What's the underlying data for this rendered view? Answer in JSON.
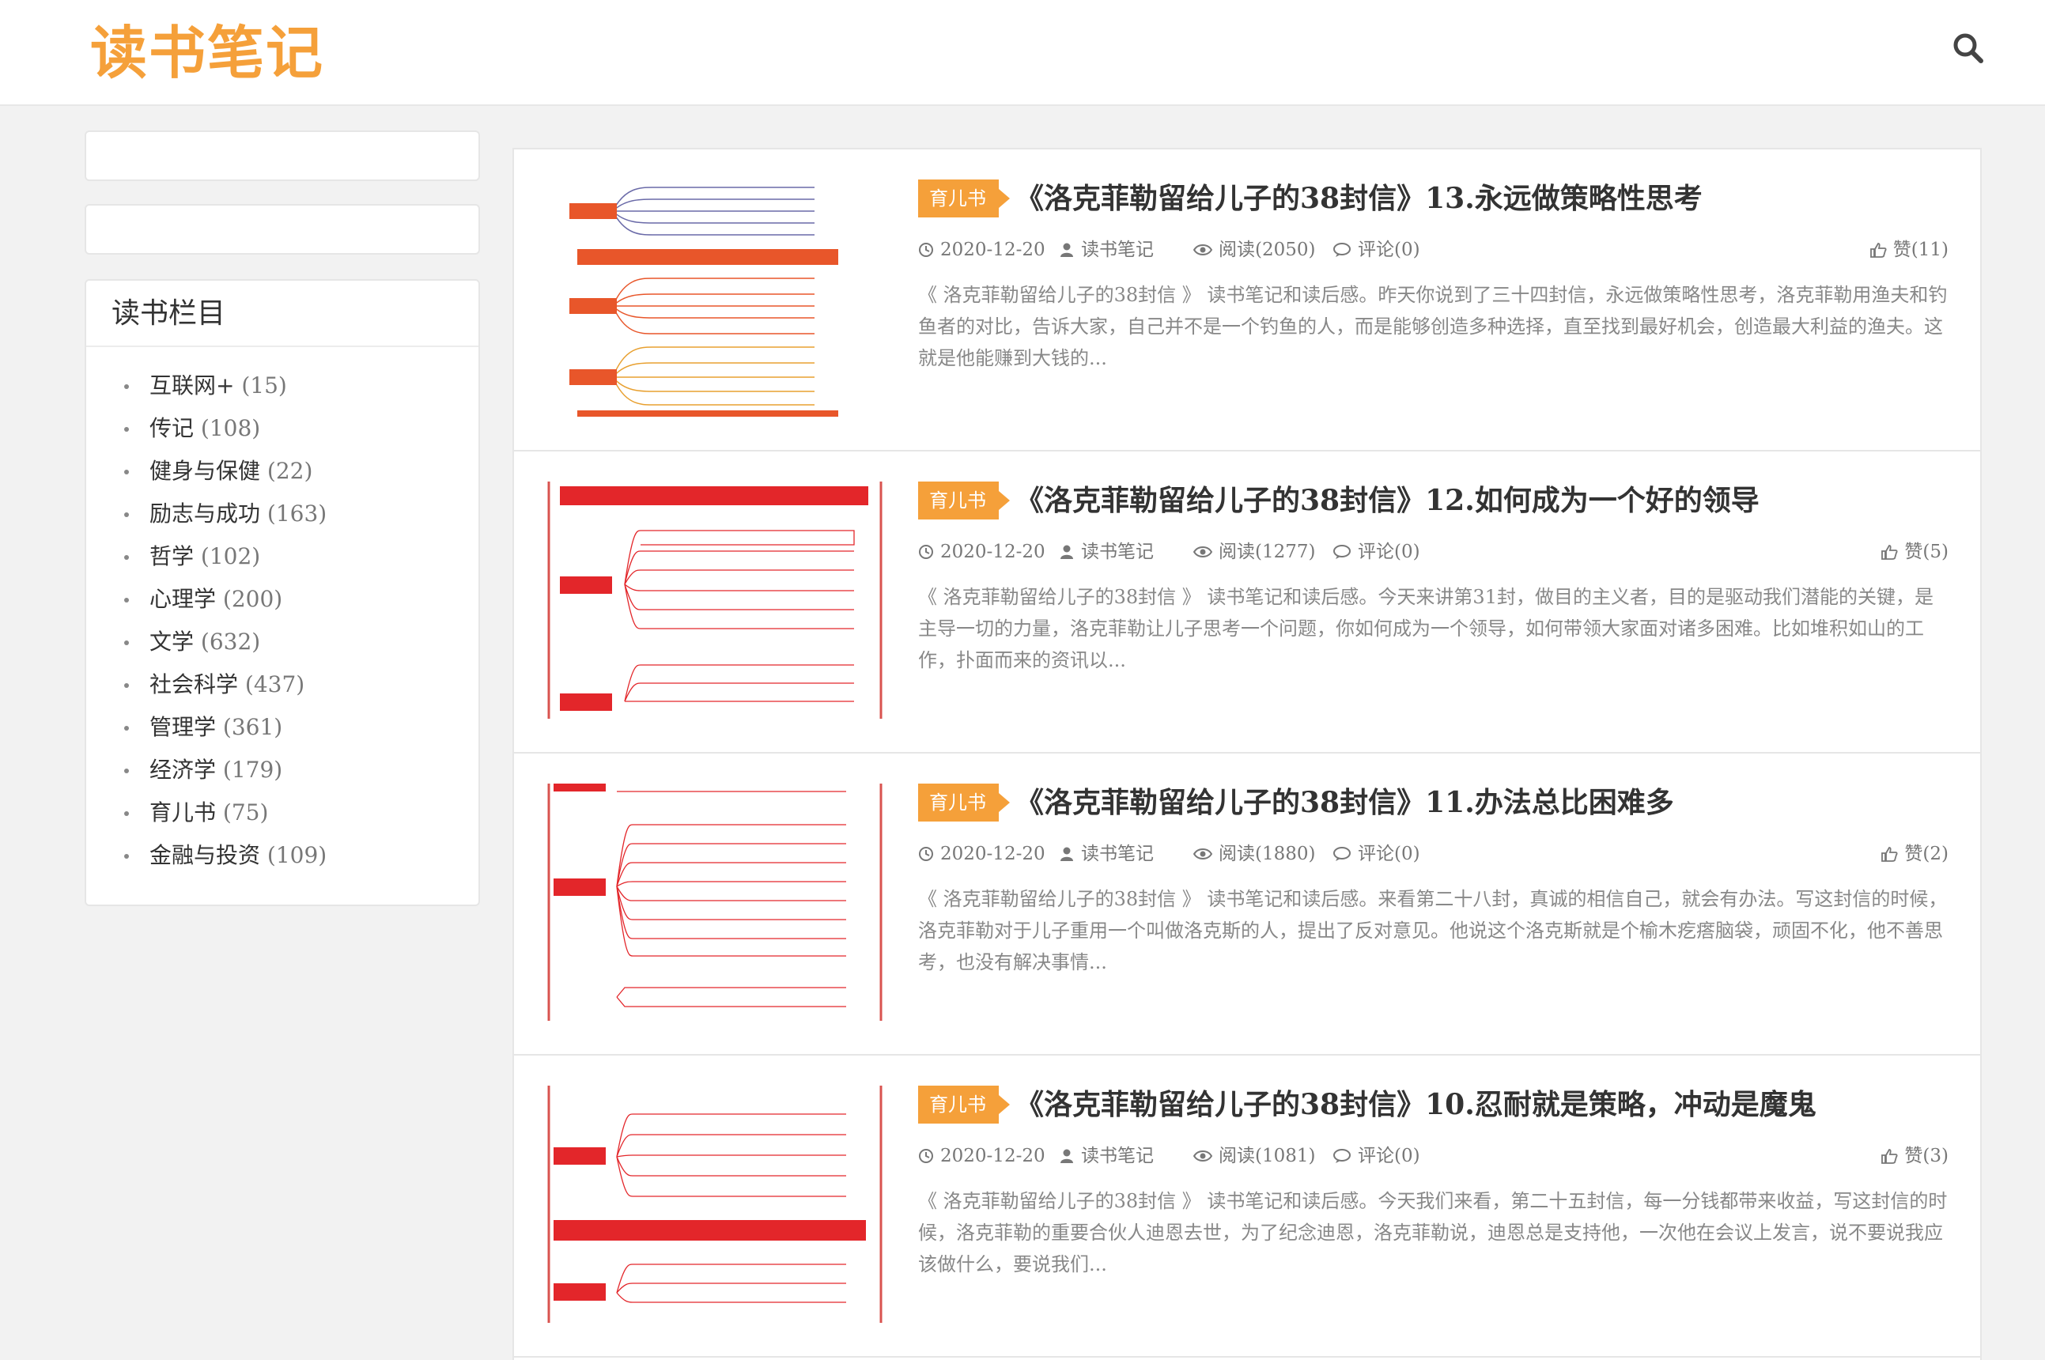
{
  "site": {
    "logo_text": "读书笔记",
    "accent_color": "#f5a03a",
    "search_icon": "search-icon"
  },
  "sidebar": {
    "category_title": "读书栏目",
    "categories": [
      {
        "name": "互联网+",
        "count": "(15)"
      },
      {
        "name": "传记",
        "count": "(108)"
      },
      {
        "name": "健身与保健",
        "count": "(22)"
      },
      {
        "name": "励志与成功",
        "count": "(163)"
      },
      {
        "name": "哲学",
        "count": "(102)"
      },
      {
        "name": "心理学",
        "count": "(200)"
      },
      {
        "name": "文学",
        "count": "(632)"
      },
      {
        "name": "社会科学",
        "count": "(437)"
      },
      {
        "name": "管理学",
        "count": "(361)"
      },
      {
        "name": "经济学",
        "count": "(179)"
      },
      {
        "name": "育儿书",
        "count": "(75)"
      },
      {
        "name": "金融与投资",
        "count": "(109)"
      }
    ]
  },
  "posts": [
    {
      "category": "育儿书",
      "title": "《洛克菲勒留给儿子的38封信》13.永远做策略性思考",
      "date": "2020-12-20",
      "author": "读书笔记",
      "views": "阅读(2050)",
      "comments": "评论(0)",
      "likes": "赞(11)",
      "excerpt": "《 洛克菲勒留给儿子的38封信 》 读书笔记和读后感。昨天你说到了三十四封信，永远做策略性思考，洛克菲勒用渔夫和钓鱼者的对比，告诉大家，自己并不是一个钓鱼的人，而是能够创造多种选择，直至找到最好机会，创造最大利益的渔夫。这就是他能赚到大钱的..."
    },
    {
      "category": "育儿书",
      "title": "《洛克菲勒留给儿子的38封信》12.如何成为一个好的领导",
      "date": "2020-12-20",
      "author": "读书笔记",
      "views": "阅读(1277)",
      "comments": "评论(0)",
      "likes": "赞(5)",
      "excerpt": "《 洛克菲勒留给儿子的38封信 》 读书笔记和读后感。今天来讲第31封，做目的主义者，目的是驱动我们潜能的关键，是主导一切的力量，洛克菲勒让儿子思考一个问题，你如何成为一个领导，如何带领大家面对诸多困难。比如堆积如山的工作，扑面而来的资讯以..."
    },
    {
      "category": "育儿书",
      "title": "《洛克菲勒留给儿子的38封信》11.办法总比困难多",
      "date": "2020-12-20",
      "author": "读书笔记",
      "views": "阅读(1880)",
      "comments": "评论(0)",
      "likes": "赞(2)",
      "excerpt": "《 洛克菲勒留给儿子的38封信 》 读书笔记和读后感。来看第二十八封，真诚的相信自己，就会有办法。写这封信的时候，洛克菲勒对于儿子重用一个叫做洛克斯的人，提出了反对意见。他说这个洛克斯就是个榆木疙瘩脑袋，顽固不化，他不善思考，也没有解决事情..."
    },
    {
      "category": "育儿书",
      "title": "《洛克菲勒留给儿子的38封信》10.忍耐就是策略，冲动是魔鬼",
      "date": "2020-12-20",
      "author": "读书笔记",
      "views": "阅读(1081)",
      "comments": "评论(0)",
      "likes": "赞(3)",
      "excerpt": "《 洛克菲勒留给儿子的38封信 》 读书笔记和读后感。今天我们来看，第二十五封信，每一分钱都带来收益，写这封信的时候，洛克菲勒的重要合伙人迪恩去世，为了纪念迪恩，洛克菲勒说，迪恩总是支持他，一次他在会议上发言，说不要说我应该做什么，要说我们..."
    }
  ]
}
